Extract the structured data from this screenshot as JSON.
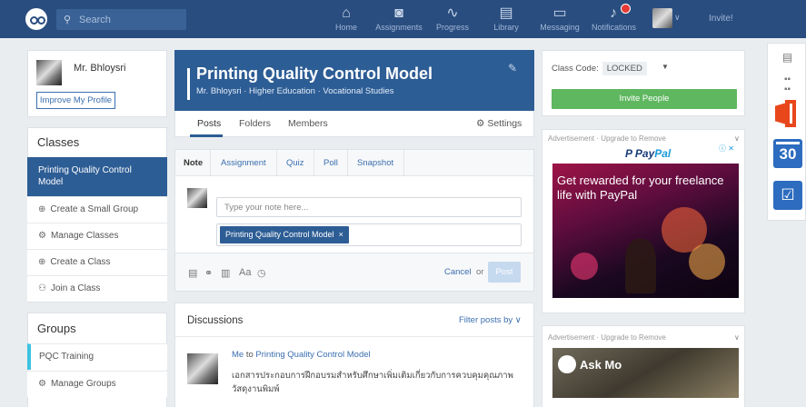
{
  "topnav": {
    "search_placeholder": "Search",
    "items": [
      {
        "label": "Home",
        "icon": "home-icon",
        "glyph": "⌂"
      },
      {
        "label": "Assignments",
        "icon": "assignments-icon",
        "glyph": "◙"
      },
      {
        "label": "Progress",
        "icon": "progress-icon",
        "glyph": "∿"
      },
      {
        "label": "Library",
        "icon": "library-icon",
        "glyph": "▤"
      },
      {
        "label": "Messaging",
        "icon": "messaging-icon",
        "glyph": "▭"
      },
      {
        "label": "Notifications",
        "icon": "bell-icon",
        "glyph": "♪"
      }
    ],
    "invite": "Invite!"
  },
  "profile": {
    "name": "Mr. Bhloysri",
    "improve_button": "Improve My Profile"
  },
  "classes": {
    "heading": "Classes",
    "active": "Printing Quality Control Model",
    "items": [
      {
        "icon": "⊕",
        "label": "Create a Small Group"
      },
      {
        "icon": "⚙",
        "label": "Manage Classes"
      },
      {
        "icon": "⊕",
        "label": "Create a Class"
      },
      {
        "icon": "⚇",
        "label": "Join a Class"
      }
    ]
  },
  "groups": {
    "heading": "Groups",
    "items": [
      {
        "icon": "",
        "label": "PQC Training"
      },
      {
        "icon": "⚙",
        "label": "Manage Groups"
      }
    ]
  },
  "group_header": {
    "title": "Printing Quality Control Model",
    "subtitle": "Mr. Bhloysri · Higher Education · Vocational Studies"
  },
  "tabs": {
    "posts": "Posts",
    "folders": "Folders",
    "members": "Members",
    "settings": "Settings"
  },
  "composer": {
    "types": [
      "Note",
      "Assignment",
      "Quiz",
      "Poll",
      "Snapshot"
    ],
    "note_placeholder": "Type your note here...",
    "recipient_chip": "Printing Quality Control Model",
    "chip_remove": "×",
    "format_label": "Aa",
    "cancel": "Cancel",
    "or": "or",
    "post": "Post"
  },
  "discussions": {
    "title": "Discussions",
    "filter": "Filter posts by ∨",
    "post": {
      "author": "Me",
      "to": "to",
      "target": "Printing Quality Control Model",
      "body": "เอกสารประกอบการฝึกอบรมสำหรับศึกษาเพิ่มเติมเกี่ยวกับการควบคุมคุณภาพวัสดุงานพิมพ์"
    }
  },
  "right": {
    "class_code_label": "Class Code:",
    "class_code_value": "LOCKED",
    "invite_button": "Invite People",
    "ad1_label": "Advertisement · Upgrade to Remove",
    "ad1_adchoices": "ⓘ ✕",
    "ad1_logo_a": "P Pay",
    "ad1_logo_b": "Pal",
    "ad1_text": "Get rewarded for your freelance life with PayPal",
    "ad2_label": "Advertisement · Upgrade to Remove",
    "ad2_text": "Ask Mo"
  },
  "rail": {
    "calendar_number": "30"
  },
  "colors": {
    "nav": "#2a4d7f",
    "accent": "#2d5d95",
    "link": "#3b6fb0",
    "invite_green": "#5fb760"
  }
}
